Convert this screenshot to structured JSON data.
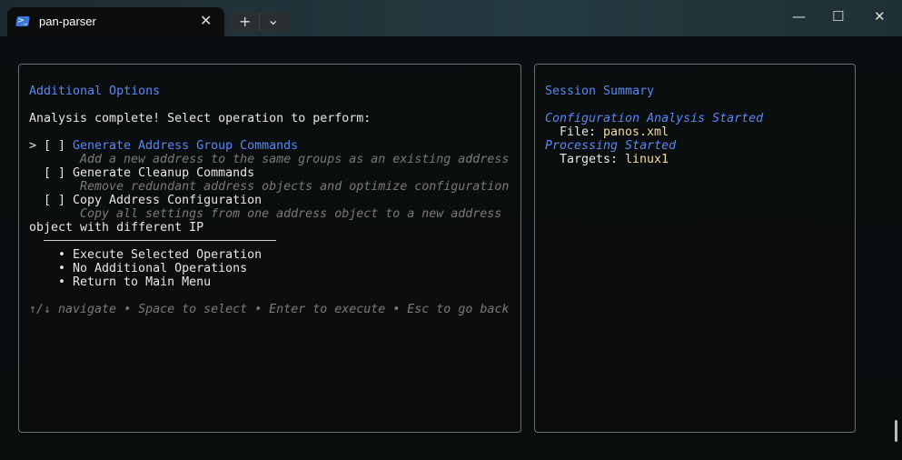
{
  "window": {
    "tab_title": "pan-parser",
    "tab_icon": "powershell-icon",
    "new_tab": "+",
    "dropdown": "⌄",
    "close_tab": "✕",
    "controls": {
      "minimize": "—",
      "maximize": "☐",
      "close": "✕"
    }
  },
  "left_panel": {
    "title": "Additional Options",
    "prompt": "Analysis complete! Select operation to perform:",
    "cursor": ">",
    "options": [
      {
        "checkbox": "[ ]",
        "label": "Generate Address Group Commands",
        "description": "Add a new address to the same groups as an existing address",
        "selected": true
      },
      {
        "checkbox": "[ ]",
        "label": "Generate Cleanup Commands",
        "description": "Remove redundant address objects and optimize configuration",
        "selected": false
      },
      {
        "checkbox": "[ ]",
        "label": "Copy Address Configuration",
        "description": "Copy all settings from one address object to a new address",
        "description_wrap": "object with different IP",
        "selected": false
      }
    ],
    "actions": [
      "• Execute Selected Operation",
      "• No Additional Operations",
      "• Return to Main Menu"
    ],
    "help": "↑/↓ navigate • Space to select • Enter to execute • Esc to go back"
  },
  "right_panel": {
    "title": "Session Summary",
    "events": [
      {
        "heading": "Configuration Analysis Started",
        "label": "File:",
        "value": "panos.xml"
      },
      {
        "heading": "Processing Started",
        "label": "Targets:",
        "value": "linux1"
      }
    ]
  },
  "colors": {
    "accent": "#5b87f0",
    "value": "#f3d9a4",
    "dim": "#7a7a7a"
  }
}
